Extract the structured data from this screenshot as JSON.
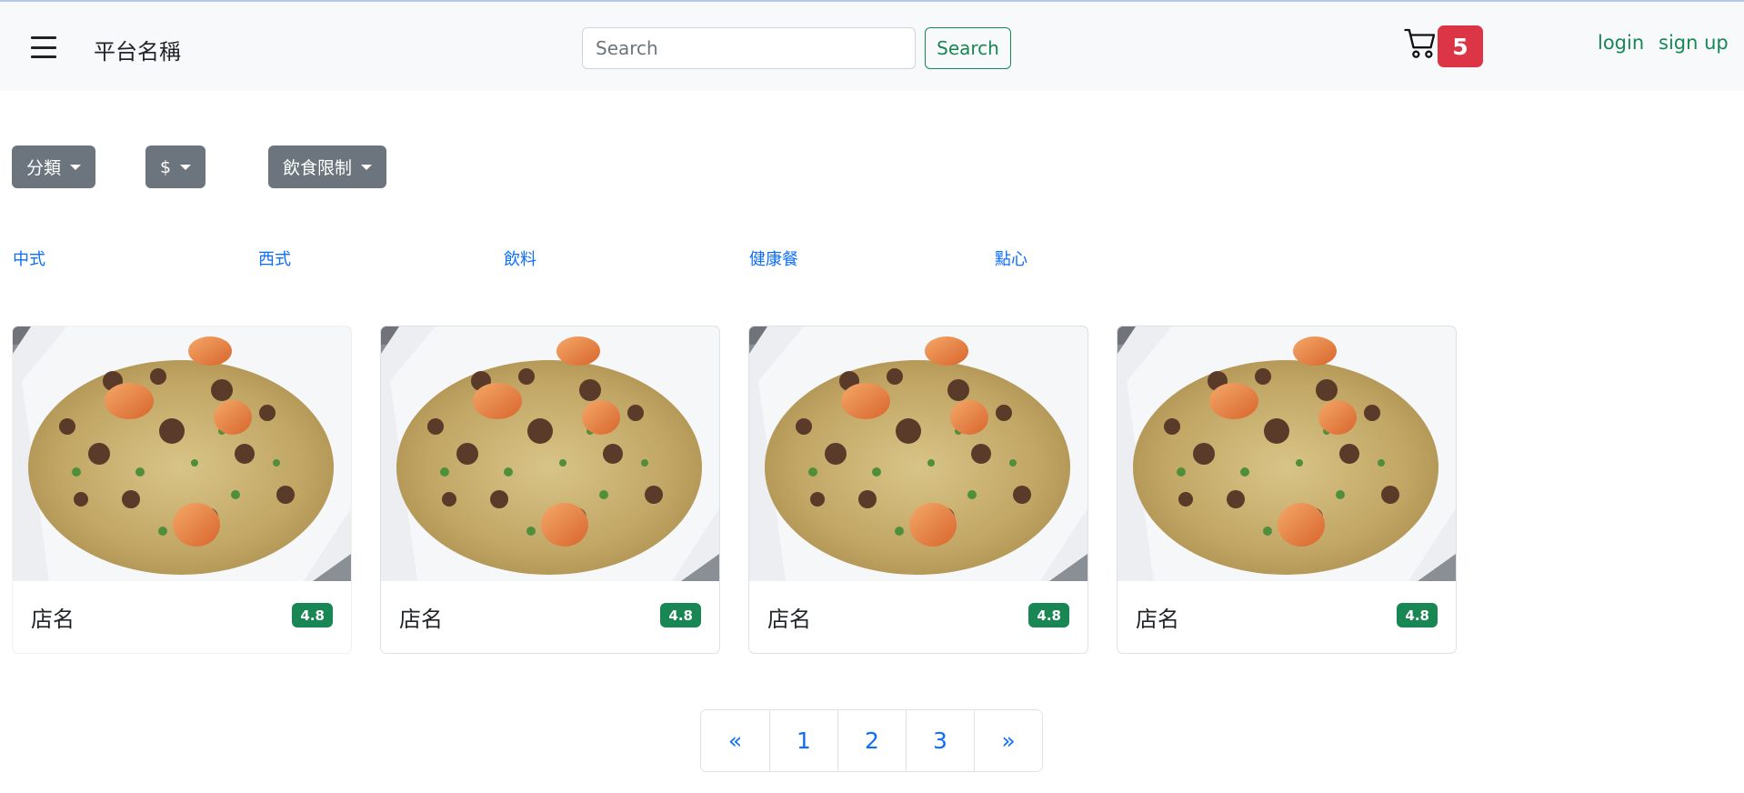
{
  "navbar": {
    "brand": "平台名稱",
    "search_placeholder": "Search",
    "search_button": "Search",
    "cart_count": "5",
    "login": "login",
    "signup": "sign up"
  },
  "filters": [
    {
      "label": "分類"
    },
    {
      "label": "$"
    },
    {
      "label": "飲食限制"
    }
  ],
  "categories": [
    "中式",
    "西式",
    "飲料",
    "健康餐",
    "點心"
  ],
  "cards": [
    {
      "name": "店名",
      "rating": "4.8"
    },
    {
      "name": "店名",
      "rating": "4.8"
    },
    {
      "name": "店名",
      "rating": "4.8"
    },
    {
      "name": "店名",
      "rating": "4.8"
    }
  ],
  "pagination": [
    "«",
    "1",
    "2",
    "3",
    "»"
  ],
  "colors": {
    "navbar_bg": "#f8f9fa",
    "success": "#198754",
    "danger": "#dc3545",
    "secondary": "#6c757d",
    "link": "#0d6efd"
  }
}
